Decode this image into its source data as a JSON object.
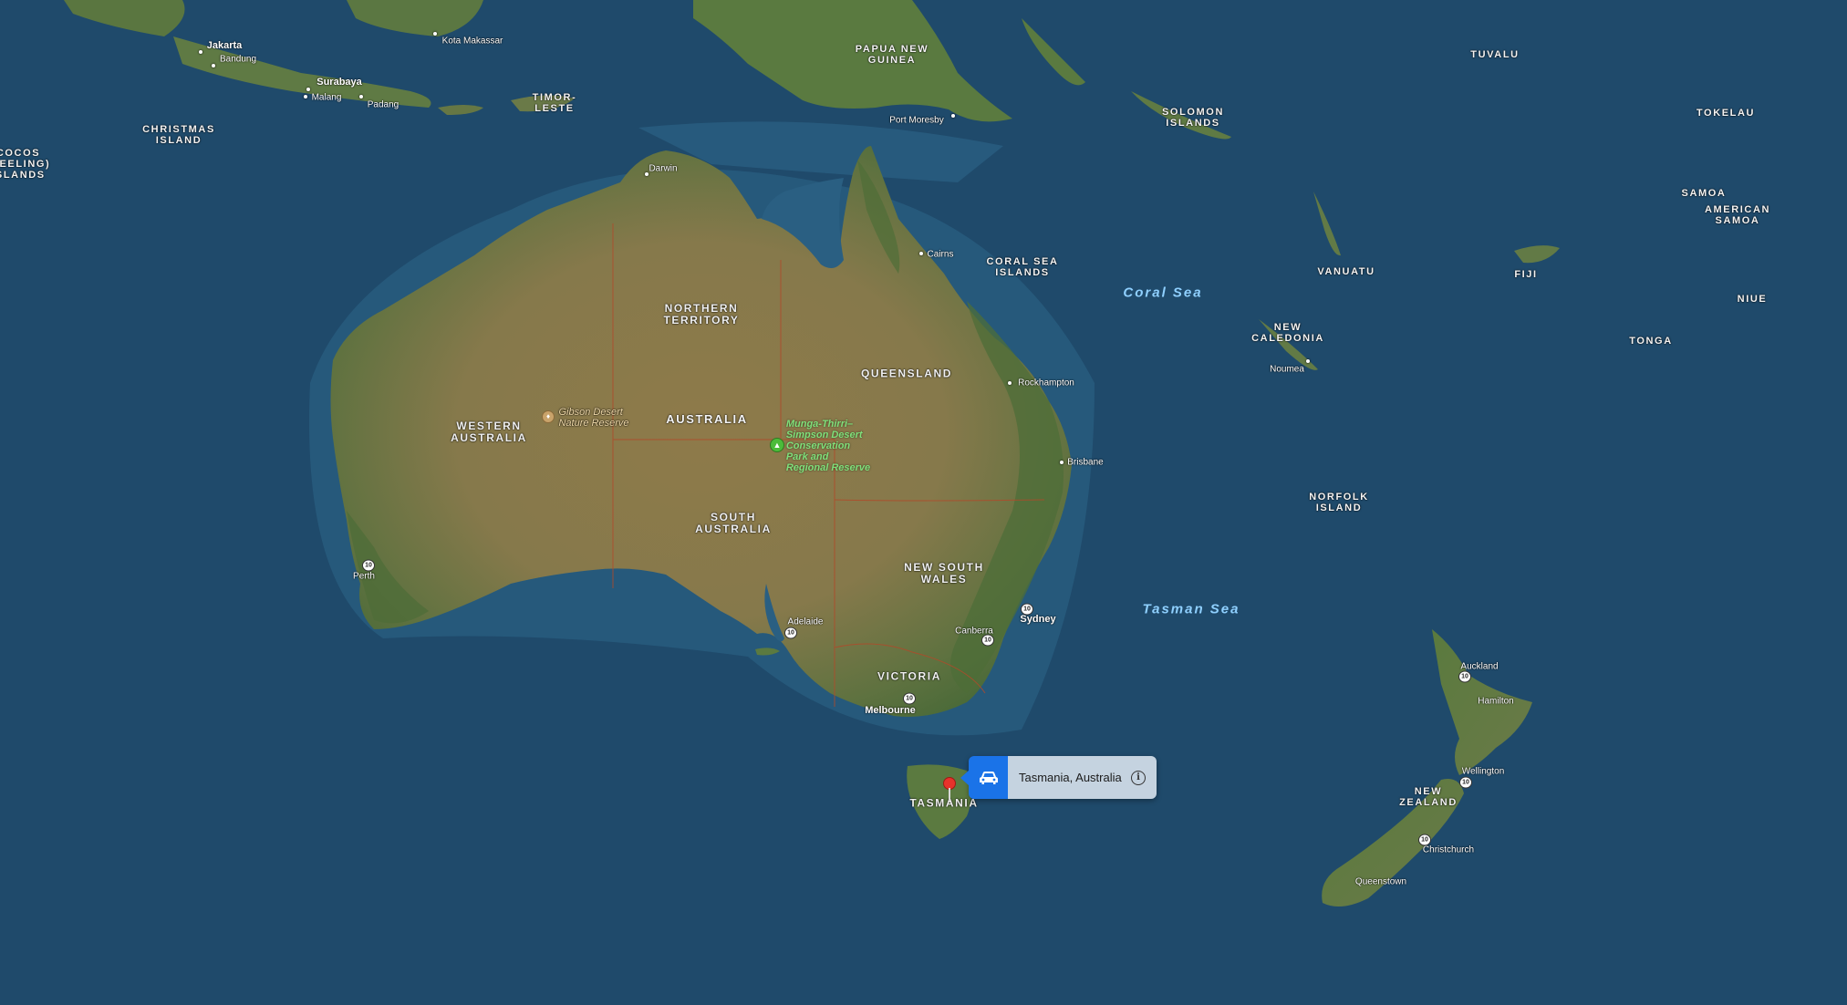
{
  "map": {
    "type": "satellite",
    "colors": {
      "ocean": "#1f4a6b",
      "ocean_shallow": "#2c6a8f",
      "land": "#8a7a4a",
      "land_green": "#4f6e38",
      "state_border": "#b04a2a",
      "accent": "#1a73e8",
      "pin": "#e8322b"
    }
  },
  "labels": {
    "countries": [
      {
        "id": "papua-new-guinea",
        "text": "PAPUA NEW\nGUINEA"
      },
      {
        "id": "timor-leste",
        "text": "TIMOR-\nLESTE"
      },
      {
        "id": "christmas-island",
        "text": "CHRISTMAS\nISLAND"
      },
      {
        "id": "cocos-islands",
        "text": "COCOS\n(KEELING)\nISLANDS"
      },
      {
        "id": "australia",
        "text": "AUSTRALIA"
      },
      {
        "id": "solomon-islands",
        "text": "SOLOMON\nISLANDS"
      },
      {
        "id": "tuvalu",
        "text": "TUVALU"
      },
      {
        "id": "tokelau",
        "text": "TOKELAU"
      },
      {
        "id": "samoa",
        "text": "SAMOA"
      },
      {
        "id": "american-samoa",
        "text": "AMERICAN\nSAMOA"
      },
      {
        "id": "vanuatu",
        "text": "VANUATU"
      },
      {
        "id": "fiji",
        "text": "FIJI"
      },
      {
        "id": "niue",
        "text": "NIUE"
      },
      {
        "id": "tonga",
        "text": "TONGA"
      },
      {
        "id": "new-caledonia",
        "text": "NEW\nCALEDONIA"
      },
      {
        "id": "norfolk-island",
        "text": "NORFOLK\nISLAND"
      },
      {
        "id": "coral-sea-islands",
        "text": "CORAL SEA\nISLANDS"
      },
      {
        "id": "new-zealand",
        "text": "NEW\nZEALAND"
      }
    ],
    "states": [
      {
        "id": "northern-territory",
        "text": "NORTHERN\nTERRITORY"
      },
      {
        "id": "western-australia",
        "text": "WESTERN\nAUSTRALIA"
      },
      {
        "id": "queensland",
        "text": "QUEENSLAND"
      },
      {
        "id": "south-australia",
        "text": "SOUTH\nAUSTRALIA"
      },
      {
        "id": "new-south-wales",
        "text": "NEW SOUTH\nWALES"
      },
      {
        "id": "victoria",
        "text": "VICTORIA"
      },
      {
        "id": "tasmania",
        "text": "TASMANIA"
      }
    ],
    "seas": [
      {
        "id": "coral-sea",
        "text": "Coral Sea"
      },
      {
        "id": "tasman-sea",
        "text": "Tasman Sea"
      }
    ],
    "cities": [
      {
        "id": "jakarta",
        "text": "Jakarta"
      },
      {
        "id": "bandung",
        "text": "Bandung"
      },
      {
        "id": "surabaya",
        "text": "Surabaya"
      },
      {
        "id": "malang",
        "text": "Malang"
      },
      {
        "id": "padang",
        "text": "Padang"
      },
      {
        "id": "kota-makassar",
        "text": "Kota Makassar"
      },
      {
        "id": "port-moresby",
        "text": "Port Moresby"
      },
      {
        "id": "darwin",
        "text": "Darwin"
      },
      {
        "id": "cairns",
        "text": "Cairns"
      },
      {
        "id": "rockhampton",
        "text": "Rockhampton"
      },
      {
        "id": "brisbane",
        "text": "Brisbane"
      },
      {
        "id": "noumea",
        "text": "Noumea"
      },
      {
        "id": "perth",
        "text": "Perth"
      },
      {
        "id": "adelaide",
        "text": "Adelaide"
      },
      {
        "id": "sydney",
        "text": "Sydney"
      },
      {
        "id": "canberra",
        "text": "Canberra"
      },
      {
        "id": "melbourne",
        "text": "Melbourne"
      },
      {
        "id": "auckland",
        "text": "Auckland"
      },
      {
        "id": "hamilton",
        "text": "Hamilton"
      },
      {
        "id": "wellington",
        "text": "Wellington"
      },
      {
        "id": "christchurch",
        "text": "Christchurch"
      },
      {
        "id": "queenstown",
        "text": "Queenstown"
      }
    ],
    "parks": [
      {
        "id": "munga-thirri",
        "text": "Munga-Thirri–\nSimpson Desert\nConservation\nPark and\nRegional Reserve"
      }
    ],
    "reserves": [
      {
        "id": "gibson-desert",
        "text": "Gibson Desert\nNature Reserve"
      }
    ]
  },
  "shield_text": "10",
  "callout": {
    "title": "Tasmania, Australia",
    "directions_icon": "car-icon",
    "info_icon": "info-icon",
    "info_glyph": "i"
  }
}
